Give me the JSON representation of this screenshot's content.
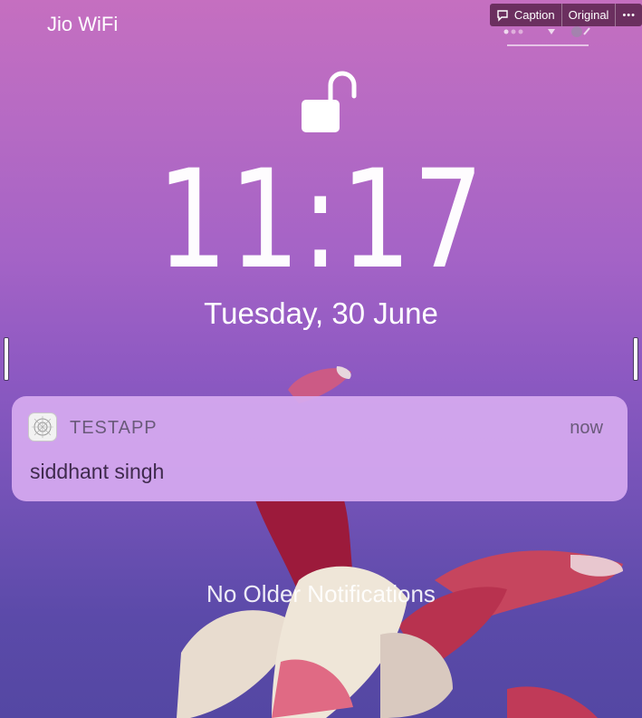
{
  "status_bar": {
    "carrier": "Jio WiFi"
  },
  "toolbar": {
    "caption_label": "Caption",
    "original_label": "Original",
    "more_label": "•••"
  },
  "lock_screen": {
    "time": "11:17",
    "date": "Tuesday, 30 June",
    "lock_state": "unlocked"
  },
  "notification": {
    "app_name": "TESTAPP",
    "timestamp": "now",
    "message": "siddhant singh"
  },
  "footer": {
    "no_older_text": "No Older Notifications"
  },
  "colors": {
    "bg_top": "#c56fc0",
    "bg_bottom": "#5447a3",
    "notification_bg": "#d7aaf0",
    "toolbar_bg": "#6b2f5f"
  }
}
